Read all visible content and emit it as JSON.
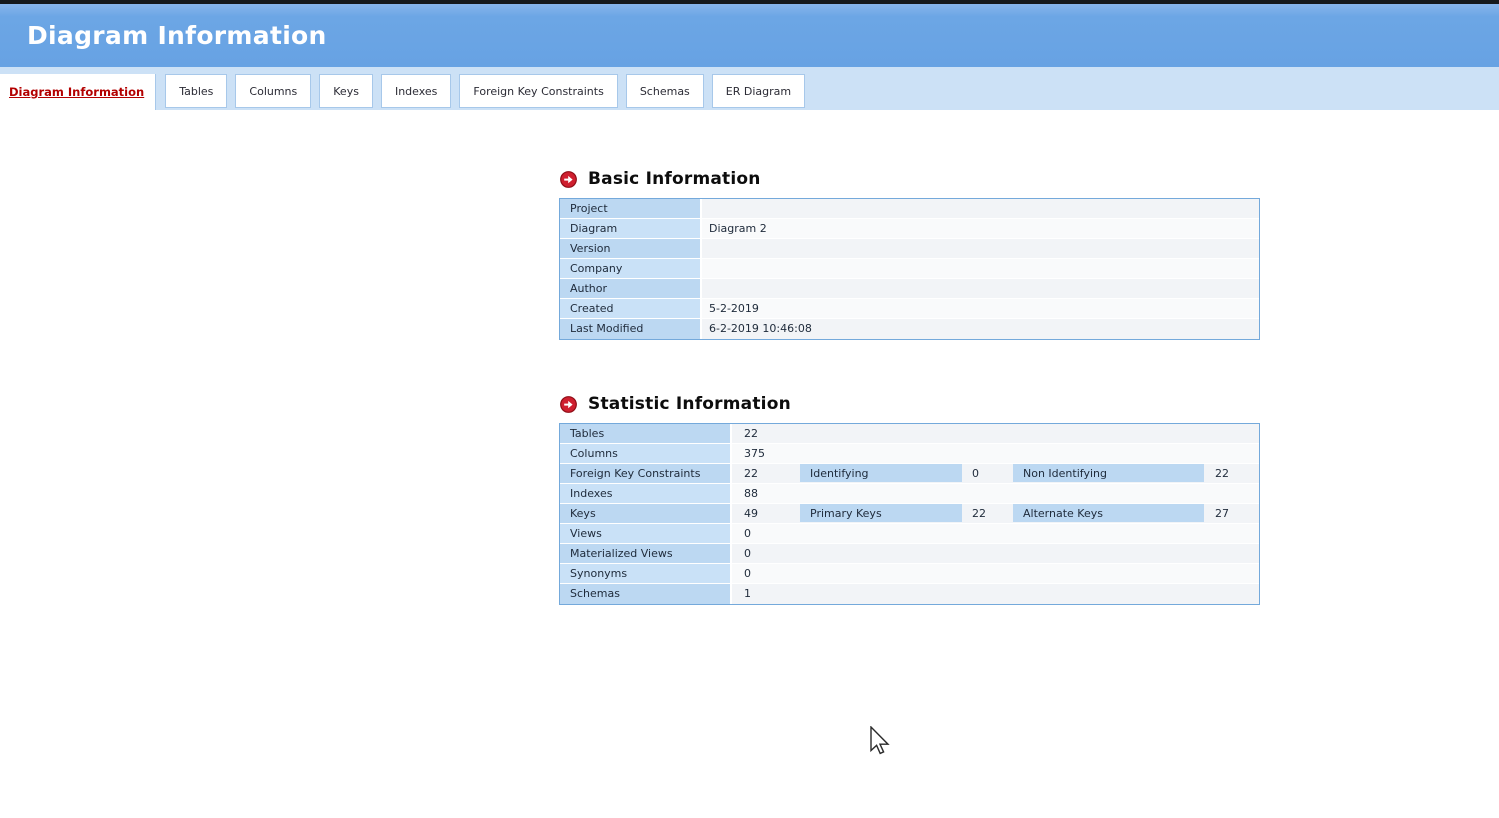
{
  "colors": {
    "top_edge": "#16191d",
    "header_blue": "#67a2e3",
    "tabbar_blue": "#cce1f6",
    "tab_border": "#a7c8ea",
    "active_tab_red": "#b30000",
    "table_border": "#74a9db",
    "label_cell_blue": "#bcd8f2",
    "icon_red": "#cf1f2f"
  },
  "header": {
    "title": "Diagram Information"
  },
  "tabs": [
    {
      "label": "Diagram Information",
      "active": true
    },
    {
      "label": "Tables",
      "active": false
    },
    {
      "label": "Columns",
      "active": false
    },
    {
      "label": "Keys",
      "active": false
    },
    {
      "label": "Indexes",
      "active": false
    },
    {
      "label": "Foreign Key Constraints",
      "active": false
    },
    {
      "label": "Schemas",
      "active": false
    },
    {
      "label": "ER Diagram",
      "active": false
    }
  ],
  "sections": {
    "basic": {
      "title": "Basic Information",
      "rows": [
        {
          "label": "Project",
          "value": ""
        },
        {
          "label": "Diagram",
          "value": "Diagram 2"
        },
        {
          "label": "Version",
          "value": ""
        },
        {
          "label": "Company",
          "value": ""
        },
        {
          "label": "Author",
          "value": ""
        },
        {
          "label": "Created",
          "value": "5-2-2019"
        },
        {
          "label": "Last Modified",
          "value": "6-2-2019 10:46:08"
        }
      ]
    },
    "statistic": {
      "title": "Statistic Information",
      "rows": [
        {
          "label": "Tables",
          "value": "22"
        },
        {
          "label": "Columns",
          "value": "375"
        },
        {
          "label": "Foreign Key Constraints",
          "value": "22",
          "sub": [
            {
              "label": "Identifying",
              "value": "0"
            },
            {
              "label": "Non Identifying",
              "value": "22"
            }
          ]
        },
        {
          "label": "Indexes",
          "value": "88"
        },
        {
          "label": "Keys",
          "value": "49",
          "sub": [
            {
              "label": "Primary Keys",
              "value": "22"
            },
            {
              "label": "Alternate Keys",
              "value": "27"
            }
          ]
        },
        {
          "label": "Views",
          "value": "0"
        },
        {
          "label": "Materialized Views",
          "value": "0"
        },
        {
          "label": "Synonyms",
          "value": "0"
        },
        {
          "label": "Schemas",
          "value": "1"
        }
      ]
    }
  }
}
